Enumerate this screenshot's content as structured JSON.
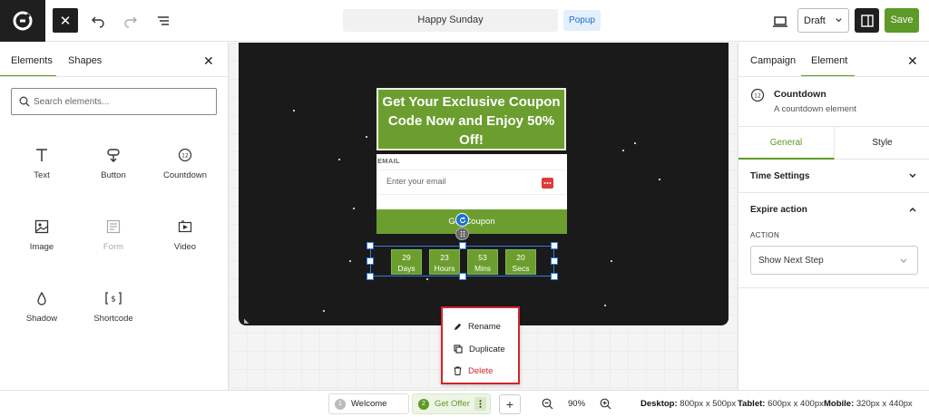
{
  "topbar": {
    "campaign_name": "Happy Sunday",
    "campaign_type": "Popup",
    "status": "Draft",
    "save_label": "Save",
    "icons": [
      "logo-icon",
      "close-icon",
      "undo-icon",
      "redo-icon",
      "layers-icon",
      "desktop-icon",
      "panel-toggle-icon"
    ]
  },
  "left_panel": {
    "tabs": [
      "Elements",
      "Shapes"
    ],
    "active_tab": "Elements",
    "search_placeholder": "Search elements...",
    "elements": [
      {
        "label": "Text",
        "icon": "text-icon",
        "enabled": true
      },
      {
        "label": "Button",
        "icon": "button-icon",
        "enabled": true
      },
      {
        "label": "Countdown",
        "icon": "countdown-icon",
        "enabled": true
      },
      {
        "label": "Image",
        "icon": "image-icon",
        "enabled": true
      },
      {
        "label": "Form",
        "icon": "form-icon",
        "enabled": false
      },
      {
        "label": "Video",
        "icon": "video-icon",
        "enabled": true
      },
      {
        "label": "Shadow",
        "icon": "shadow-icon",
        "enabled": true
      },
      {
        "label": "Shortcode",
        "icon": "shortcode-icon",
        "enabled": true
      }
    ]
  },
  "canvas": {
    "headline": "Get Your Exclusive Coupon Code Now and Enjoy 50% Off!",
    "email_label": "EMAIL",
    "email_placeholder": "Enter your email",
    "button_label": "Get Coupon",
    "countdown": [
      {
        "value": "29",
        "unit": "Days"
      },
      {
        "value": "23",
        "unit": "Hours"
      },
      {
        "value": "53",
        "unit": "Mins"
      },
      {
        "value": "20",
        "unit": "Secs"
      }
    ],
    "context_menu": [
      {
        "label": "Rename",
        "icon": "pencil-icon"
      },
      {
        "label": "Duplicate",
        "icon": "duplicate-icon"
      },
      {
        "label": "Delete",
        "icon": "trash-icon"
      }
    ],
    "accent_color": "#6b9e2f",
    "selection_color": "#2f7de0",
    "danger_color": "#d0262c"
  },
  "right_panel": {
    "tabs": [
      "Campaign",
      "Element"
    ],
    "active_tab": "Element",
    "element_title": "Countdown",
    "element_desc": "A countdown element",
    "subtabs": [
      "General",
      "Style"
    ],
    "active_subtab": "General",
    "sections": {
      "time_settings": "Time Settings",
      "expire_action": "Expire action"
    },
    "action_label": "ACTION",
    "action_value": "Show Next Step"
  },
  "bottombar": {
    "steps": [
      {
        "num": "1",
        "label": "Welcome"
      },
      {
        "num": "2",
        "label": "Get Offer"
      }
    ],
    "zoom": "90%",
    "dimensions": [
      {
        "label": "Desktop:",
        "value": "800px x 500px"
      },
      {
        "label": "Tablet:",
        "value": "600px x 400px"
      },
      {
        "label": "Mobile:",
        "value": "320px x 440px"
      }
    ]
  }
}
